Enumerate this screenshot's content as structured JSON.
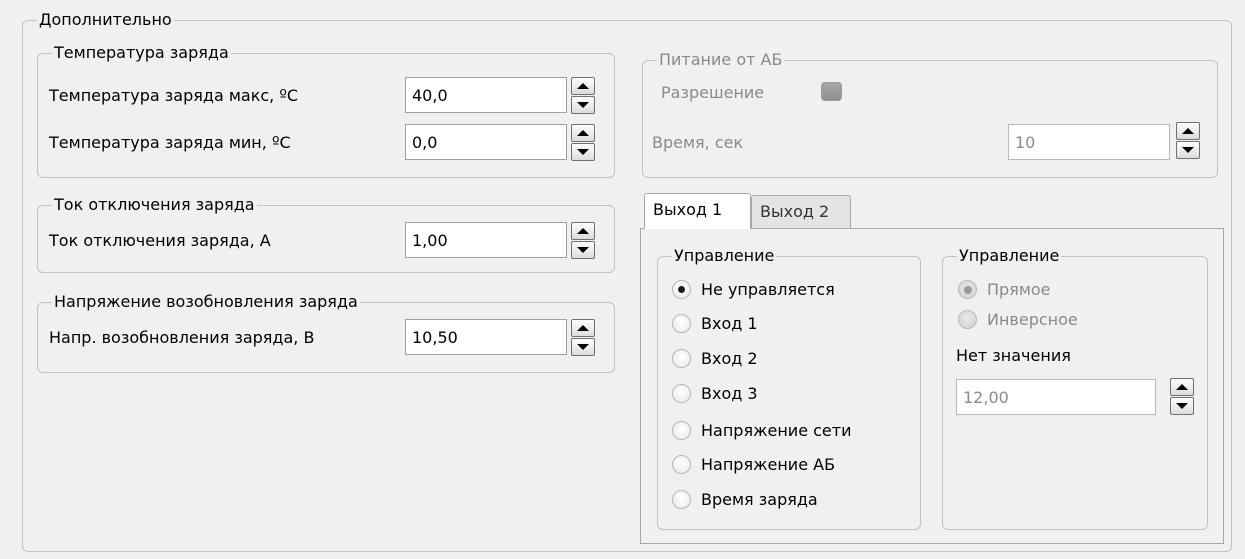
{
  "outer_group": {
    "title": "Дополнительно"
  },
  "temp_group": {
    "title": "Температура заряда",
    "max_label": "Температура заряда макс, ºС",
    "max_value": "40,0",
    "min_label": "Температура заряда мин, ºС",
    "min_value": "0,0"
  },
  "current_group": {
    "title": "Ток отключения заряда",
    "label": "Ток отключения заряда, А",
    "value": "1,00"
  },
  "voltage_group": {
    "title": "Напряжение возобновления заряда",
    "label": "Напр. возобновления заряда, В",
    "value": "10,50"
  },
  "battery_group": {
    "title": "Питание от АБ",
    "enable_label": "Разрешение",
    "enable_checked": false,
    "time_label": "Время, сек",
    "time_value": "10"
  },
  "tabs": [
    {
      "label": "Выход 1",
      "active": true
    },
    {
      "label": "Выход 2",
      "active": false
    }
  ],
  "control_group": {
    "title": "Управление",
    "options": [
      {
        "label": "Не управляется",
        "selected": true
      },
      {
        "label": "Вход 1",
        "selected": false
      },
      {
        "label": "Вход 2",
        "selected": false
      },
      {
        "label": "Вход 3",
        "selected": false
      },
      {
        "label": "Напряжение сети",
        "selected": false
      },
      {
        "label": "Напряжение АБ",
        "selected": false
      },
      {
        "label": "Время заряда",
        "selected": false
      }
    ]
  },
  "mode_group": {
    "title": "Управление",
    "options": [
      {
        "label": "Прямое",
        "selected": true
      },
      {
        "label": "Инверсное",
        "selected": false
      }
    ],
    "no_value_label": "Нет значения",
    "no_value_value": "12,00"
  },
  "icons": {
    "spin_up": "arrow-up-icon",
    "spin_down": "arrow-down-icon"
  }
}
